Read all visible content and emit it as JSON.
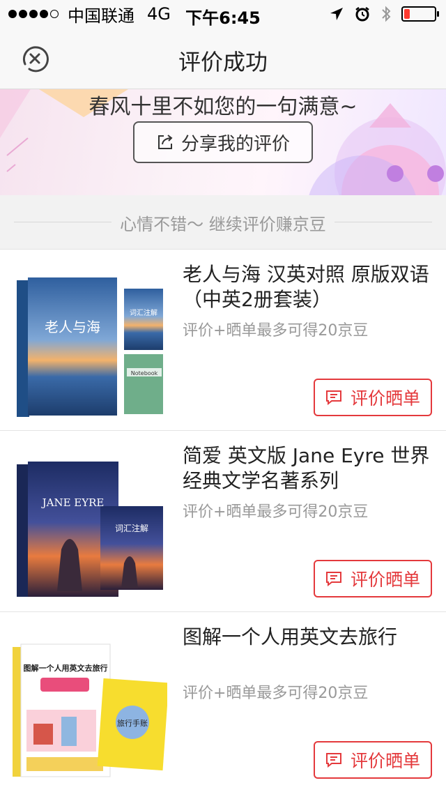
{
  "status_bar": {
    "carrier": "中国联通",
    "network": "4G",
    "time": "下午6:45",
    "signal_dots_filled": 4,
    "signal_dots_total": 5,
    "battery_level": 0.12,
    "battery_color": "#ff3b30"
  },
  "nav": {
    "title": "评价成功",
    "close_icon": "close-circle-icon"
  },
  "banner": {
    "slogan": "春风十里不如您的一句满意~",
    "share_label": "分享我的评价",
    "share_icon": "share-icon"
  },
  "divider": {
    "text": "心情不错～ 继续评价赚京豆"
  },
  "products": [
    {
      "name": "老人与海 汉英对照 原版双语（中英2册套装）",
      "hint": "评价+晒单最多可得20京豆",
      "button": "评价晒单",
      "cover": {
        "main_title": "老人与海",
        "side_title": "词汇注解",
        "note_label": "Notebook"
      }
    },
    {
      "name": "简爱 英文版 Jane Eyre 世界经典文学名著系列",
      "hint": "评价+晒单最多可得20京豆",
      "button": "评价晒单",
      "cover": {
        "main_title": "JANE EYRE",
        "side_title": "词汇注解"
      }
    },
    {
      "name": "图解一个人用英文去旅行",
      "hint": "评价+晒单最多可得20京豆",
      "button": "评价晒单",
      "cover": {
        "main_title": "图解一个人用英文去旅行",
        "side_title": "旅行手账"
      }
    }
  ],
  "colors": {
    "accent": "#e4393c",
    "nav_bg": "#f8f8f8",
    "hint": "#999999"
  }
}
